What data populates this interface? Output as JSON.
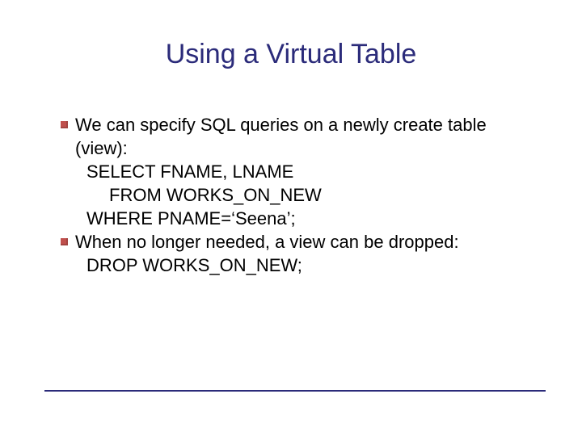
{
  "title": "Using a Virtual Table",
  "bullets": [
    {
      "text": "We can specify SQL queries on a newly create table (view):",
      "code": [
        "SELECT FNAME, LNAME",
        "FROM WORKS_ON_NEW",
        "WHERE PNAME=‘Seena’;"
      ],
      "indent": [
        1,
        2,
        1
      ]
    },
    {
      "text": "When no longer needed, a view can be dropped:",
      "code": [
        "DROP WORKS_ON_NEW;"
      ],
      "indent": [
        1
      ]
    }
  ]
}
